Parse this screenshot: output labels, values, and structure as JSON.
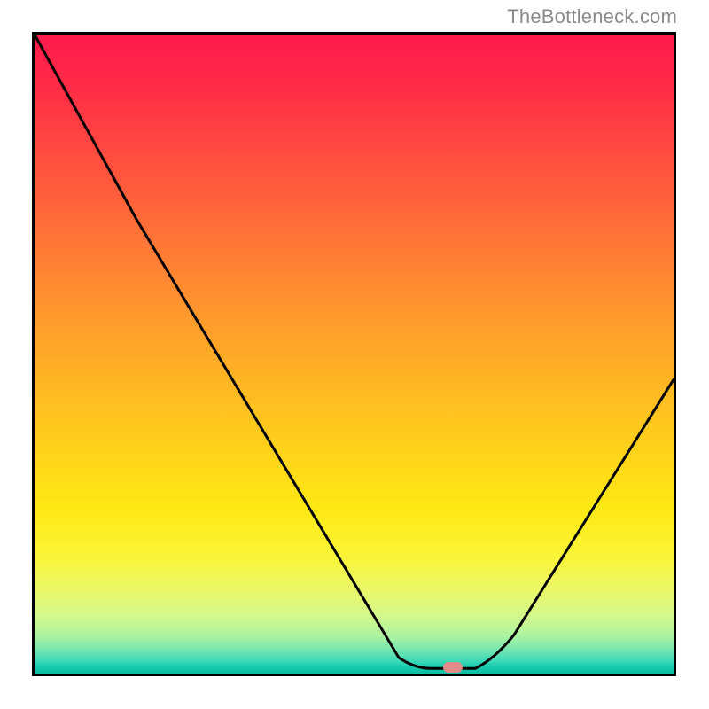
{
  "watermark": "TheBottleneck.com",
  "chart_data": {
    "type": "line",
    "title": "",
    "xlabel": "",
    "ylabel": "",
    "xlim": [
      0,
      100
    ],
    "ylim": [
      0,
      100
    ],
    "grid": false,
    "series": [
      {
        "name": "curve",
        "points": [
          {
            "x": 0,
            "y": 100
          },
          {
            "x": 16,
            "y": 71
          },
          {
            "x": 57,
            "y": 2.5
          },
          {
            "x": 62,
            "y": 0.8
          },
          {
            "x": 69,
            "y": 0.8
          },
          {
            "x": 75,
            "y": 6
          },
          {
            "x": 100,
            "y": 46
          }
        ]
      }
    ],
    "marker": {
      "x": 65.5,
      "y": 1.0
    },
    "background_gradient": {
      "top": "#ff1a4d",
      "mid": "#ffd21a",
      "bottom": "#0abf9e"
    }
  }
}
